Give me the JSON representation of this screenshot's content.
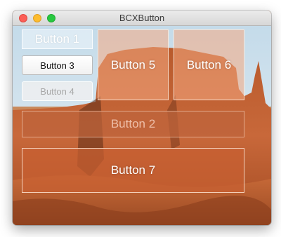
{
  "window": {
    "title": "BCXButton"
  },
  "buttons": {
    "b1": {
      "label": "Button 1"
    },
    "b2": {
      "label": "Button 2",
      "state": "disabled"
    },
    "b3": {
      "label": "Button 3"
    },
    "b4": {
      "label": "Button 4",
      "state": "disabled"
    },
    "b5": {
      "label": "Button 5"
    },
    "b6": {
      "label": "Button 6"
    },
    "b7": {
      "label": "Button 7"
    }
  },
  "colors": {
    "close": "#fc5f57",
    "minimize": "#fdbc2e",
    "zoom": "#28c840",
    "background_rock": "#c56a36",
    "background_sky": "#cfe1ec"
  }
}
